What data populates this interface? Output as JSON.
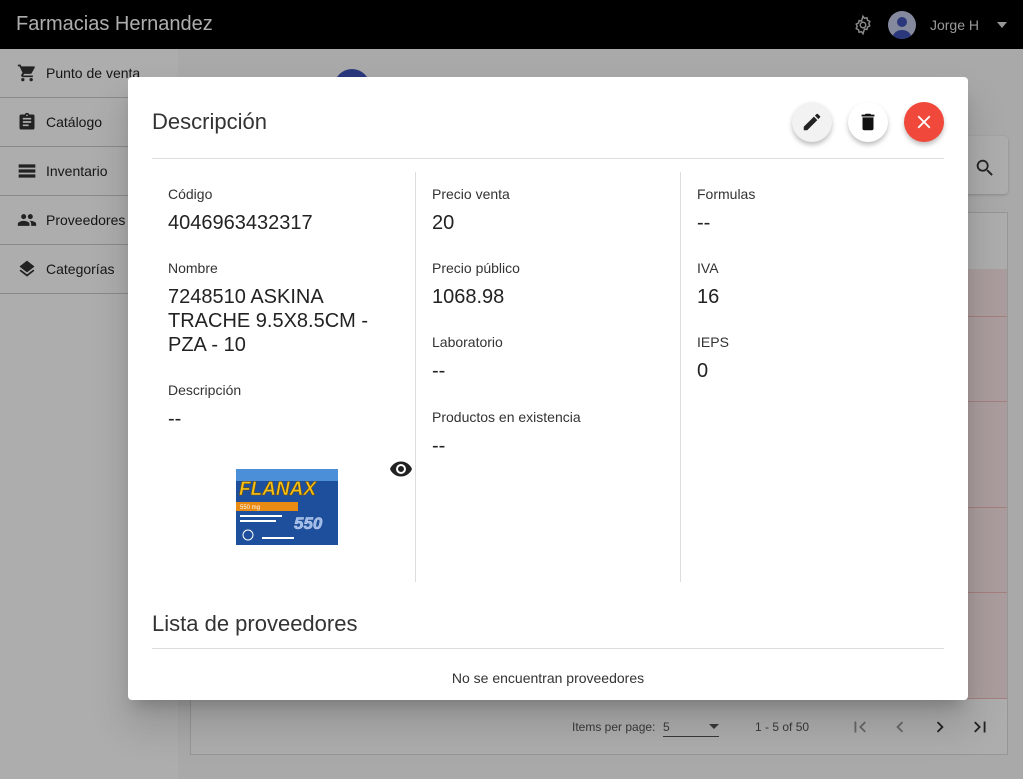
{
  "app": {
    "title": "Farmacias Hernandez",
    "user": "Jorge H"
  },
  "sidebar": {
    "items": [
      {
        "label": "Punto de venta",
        "icon": "cart-icon"
      },
      {
        "label": "Catálogo",
        "icon": "clipboard-icon"
      },
      {
        "label": "Inventario",
        "icon": "list-icon"
      },
      {
        "label": "Proveedores",
        "icon": "people-icon"
      },
      {
        "label": "Categorías",
        "icon": "layers-icon"
      }
    ]
  },
  "background": {
    "pager": {
      "items_per_page_label": "Items per page:",
      "items_per_page_value": "5",
      "range": "1 - 5 of 50"
    }
  },
  "dialog": {
    "title": "Descripción",
    "fields": {
      "codigo": {
        "label": "Código",
        "value": "4046963432317"
      },
      "nombre": {
        "label": "Nombre",
        "value": "7248510 ASKINA TRACHE 9.5X8.5CM - PZA - 10"
      },
      "descripcion": {
        "label": "Descripción",
        "value": "--"
      },
      "precio_venta": {
        "label": "Precio venta",
        "value": "20"
      },
      "precio_publico": {
        "label": "Precio público",
        "value": "1068.98"
      },
      "laboratorio": {
        "label": "Laboratorio",
        "value": "--"
      },
      "existencia": {
        "label": "Productos en existencia",
        "value": "--"
      },
      "formulas": {
        "label": "Formulas",
        "value": "--"
      },
      "iva": {
        "label": "IVA",
        "value": "16"
      },
      "ieps": {
        "label": "IEPS",
        "value": "0"
      }
    },
    "product_image": {
      "brand": "FLANAX",
      "strength": "550 mg",
      "big_number": "550"
    },
    "providers": {
      "title": "Lista de proveedores",
      "empty_text": "No se encuentran proveedores"
    }
  },
  "colors": {
    "topbar": "#000000",
    "sidebar": "#ffffff",
    "close": "#f0493b",
    "accent": "#3f51b5"
  }
}
